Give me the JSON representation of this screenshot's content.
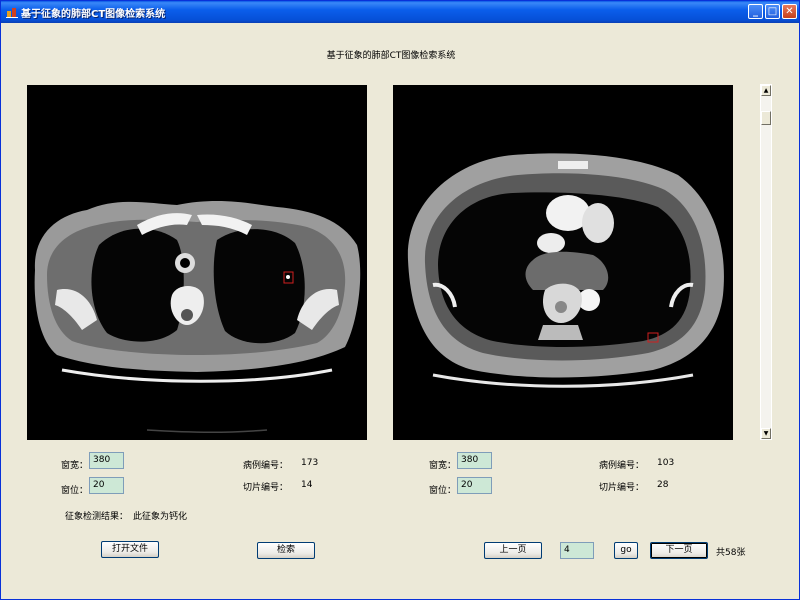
{
  "window": {
    "title": "基于征象的肺部CT图像检索系统",
    "minimize": "_",
    "maximize": "□",
    "close": "✕"
  },
  "heading": "基于征象的肺部CT图像检索系统",
  "left_panel": {
    "window_width_label": "窗宽：",
    "window_width_value": "380",
    "window_level_label": "窗位：",
    "window_level_value": "20",
    "case_id_label": "病例编号：",
    "case_id_value": "173",
    "slice_id_label": "切片编号：",
    "slice_id_value": "14",
    "detect_label": "征象检测结果：",
    "detect_value": "此征象为钙化"
  },
  "right_panel": {
    "window_width_label": "窗宽：",
    "window_width_value": "380",
    "window_level_label": "窗位：",
    "window_level_value": "20",
    "case_id_label": "病例编号：",
    "case_id_value": "103",
    "slice_id_label": "切片编号：",
    "slice_id_value": "28"
  },
  "buttons": {
    "open_file": "打开文件",
    "search": "检索",
    "prev_page": "上一页",
    "go": "go",
    "next_page": "下一页"
  },
  "pager": {
    "page_value": "4",
    "total": "共58张"
  },
  "scrollbar": {
    "up": "▲",
    "down": "▼"
  },
  "colors": {
    "title_bar": "#0B5EEB",
    "field_bg": "#CDE8D6",
    "window_bg": "#ECE9D8",
    "marker": "#D02020"
  }
}
